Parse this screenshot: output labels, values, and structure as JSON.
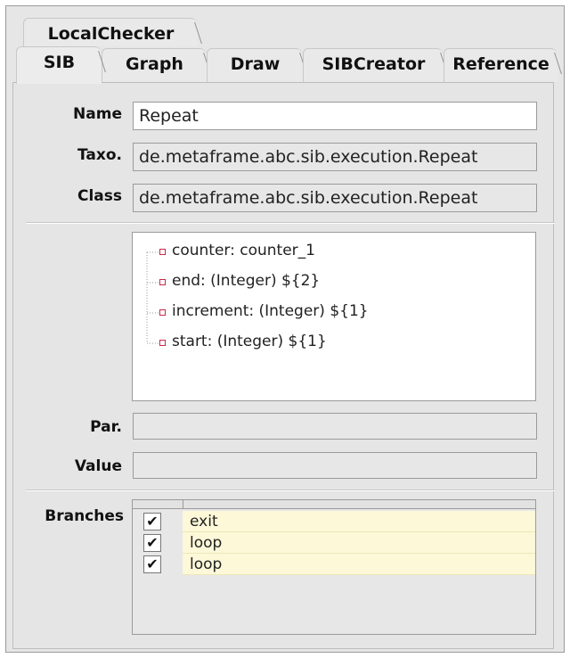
{
  "tabs_row1": [
    {
      "label": "LocalChecker"
    }
  ],
  "tabs_row2": [
    {
      "label": "SIB"
    },
    {
      "label": "Graph"
    },
    {
      "label": "Draw"
    },
    {
      "label": "SIBCreator"
    },
    {
      "label": "Reference"
    }
  ],
  "active_tab": "SIB",
  "form": {
    "name_label": "Name",
    "name_value": "Repeat",
    "taxo_label": "Taxo.",
    "taxo_value": "de.metaframe.abc.sib.execution.Repeat",
    "class_label": "Class",
    "class_value": "de.metaframe.abc.sib.execution.Repeat",
    "par_label": "Par.",
    "par_value": "",
    "value_label": "Value",
    "value_value": ""
  },
  "parameters": [
    {
      "text": "counter: counter_1"
    },
    {
      "text": "end: (Integer) ${2}"
    },
    {
      "text": "increment: (Integer) ${1}"
    },
    {
      "text": "start: (Integer) ${1}"
    }
  ],
  "branches_label": "Branches",
  "branches": [
    {
      "name": "exit",
      "checked": true,
      "check_glyph": "✔"
    },
    {
      "name": "loop",
      "checked": true,
      "check_glyph": "✔"
    },
    {
      "name": "loop",
      "checked": true,
      "check_glyph": "✔"
    }
  ],
  "colors": {
    "node_marker": "#c8284a",
    "branch_row_bg": "#fcf8d8",
    "panel_bg": "#e5e5e5"
  }
}
